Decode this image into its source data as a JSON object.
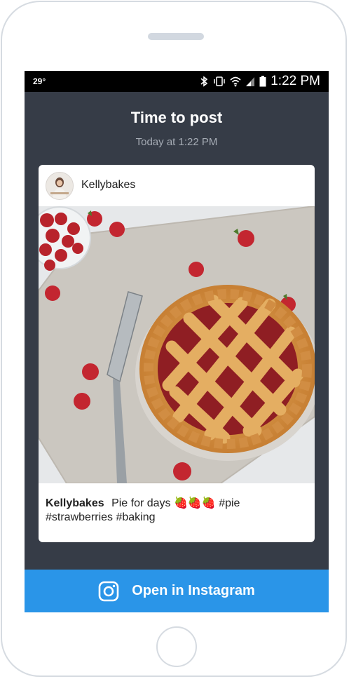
{
  "status": {
    "temperature": "29°",
    "time": "1:22 PM"
  },
  "header": {
    "title": "Time to post",
    "subtitle": "Today at 1:22 PM"
  },
  "post": {
    "username": "Kellybakes",
    "caption_user": "Kellybakes",
    "caption_text": "Pie for days 🍓🍓🍓 #pie #strawberries #baking"
  },
  "cta": {
    "label": "Open in Instagram"
  },
  "colors": {
    "screen_bg": "#363c47",
    "cta_bg": "#2a95e8",
    "status_bar": "#000000"
  },
  "icons": [
    "bluetooth-icon",
    "vibrate-icon",
    "wifi-icon",
    "signal-icon",
    "battery-icon",
    "instagram-icon"
  ]
}
